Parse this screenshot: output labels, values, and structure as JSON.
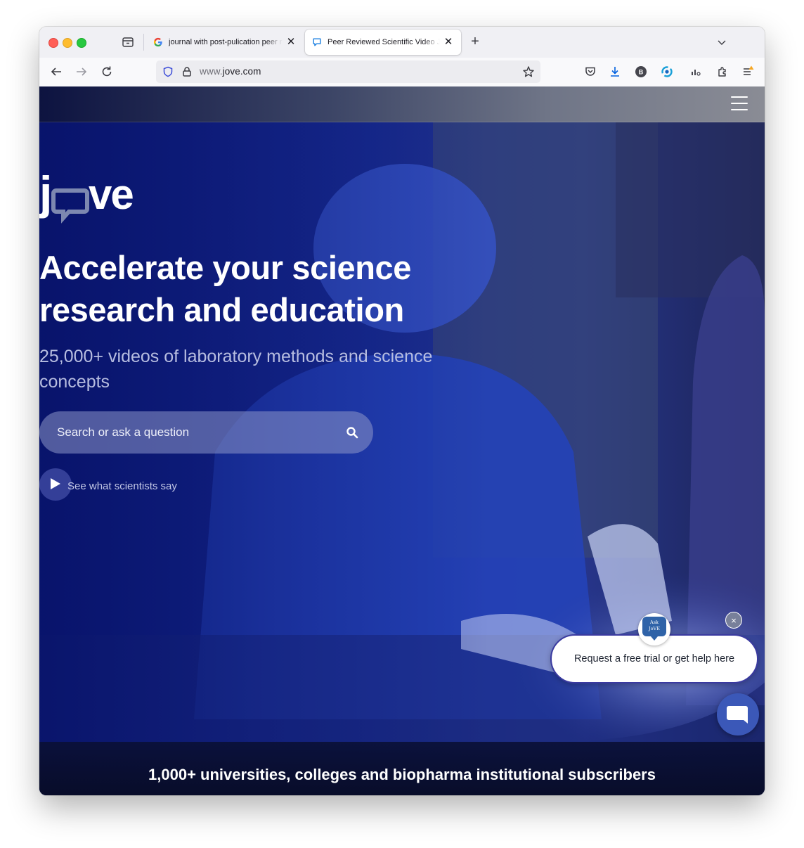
{
  "browser": {
    "tabs": [
      {
        "title": "journal with post-pulication peer review",
        "favicon": "google-icon",
        "active": false
      },
      {
        "title": "Peer Reviewed Scientific Video Journal",
        "favicon": "jove-chat-icon",
        "active": true
      }
    ],
    "url_prefix": "www.",
    "url_domain": "jove.com",
    "colors": {
      "accent_blue": "#0060df"
    }
  },
  "site": {
    "logo_text": "jove",
    "headline": "Accelerate your science research and education",
    "subheadline": "25,000+ videos of laboratory methods and science concepts",
    "search": {
      "placeholder": "Search or ask a question"
    },
    "video_link": "See what scientists say",
    "chat": {
      "badge_line1": "Ask",
      "badge_line2": "JoVE",
      "bubble_text": "Request a free trial or get help here",
      "close_symbol": "×"
    },
    "footer_banner": "1,000+ universities, colleges and biopharma institutional subscribers",
    "colors": {
      "hero_blue": "#1a2a8a",
      "launcher": "#3b58b8"
    }
  }
}
